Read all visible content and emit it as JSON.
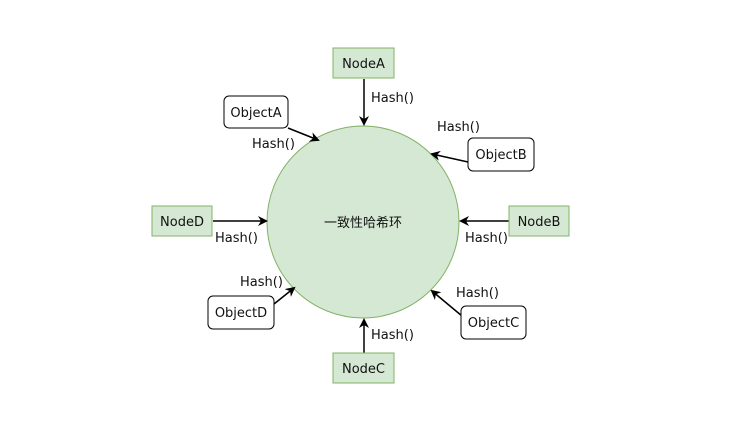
{
  "diagram": {
    "ring_label": "一致性哈希环",
    "nodes": {
      "a": "NodeA",
      "b": "NodeB",
      "c": "NodeC",
      "d": "NodeD"
    },
    "objects": {
      "a": "ObjectA",
      "b": "ObjectB",
      "c": "ObjectC",
      "d": "ObjectD"
    },
    "hash_label": "Hash()"
  },
  "colors": {
    "node_fill": "#d5e8d4",
    "node_stroke": "#82b366",
    "ring_fill": "#d5e8d4",
    "ring_stroke": "#82b366",
    "object_fill": "#ffffff",
    "object_stroke": "#000000",
    "edge": "#000000"
  }
}
